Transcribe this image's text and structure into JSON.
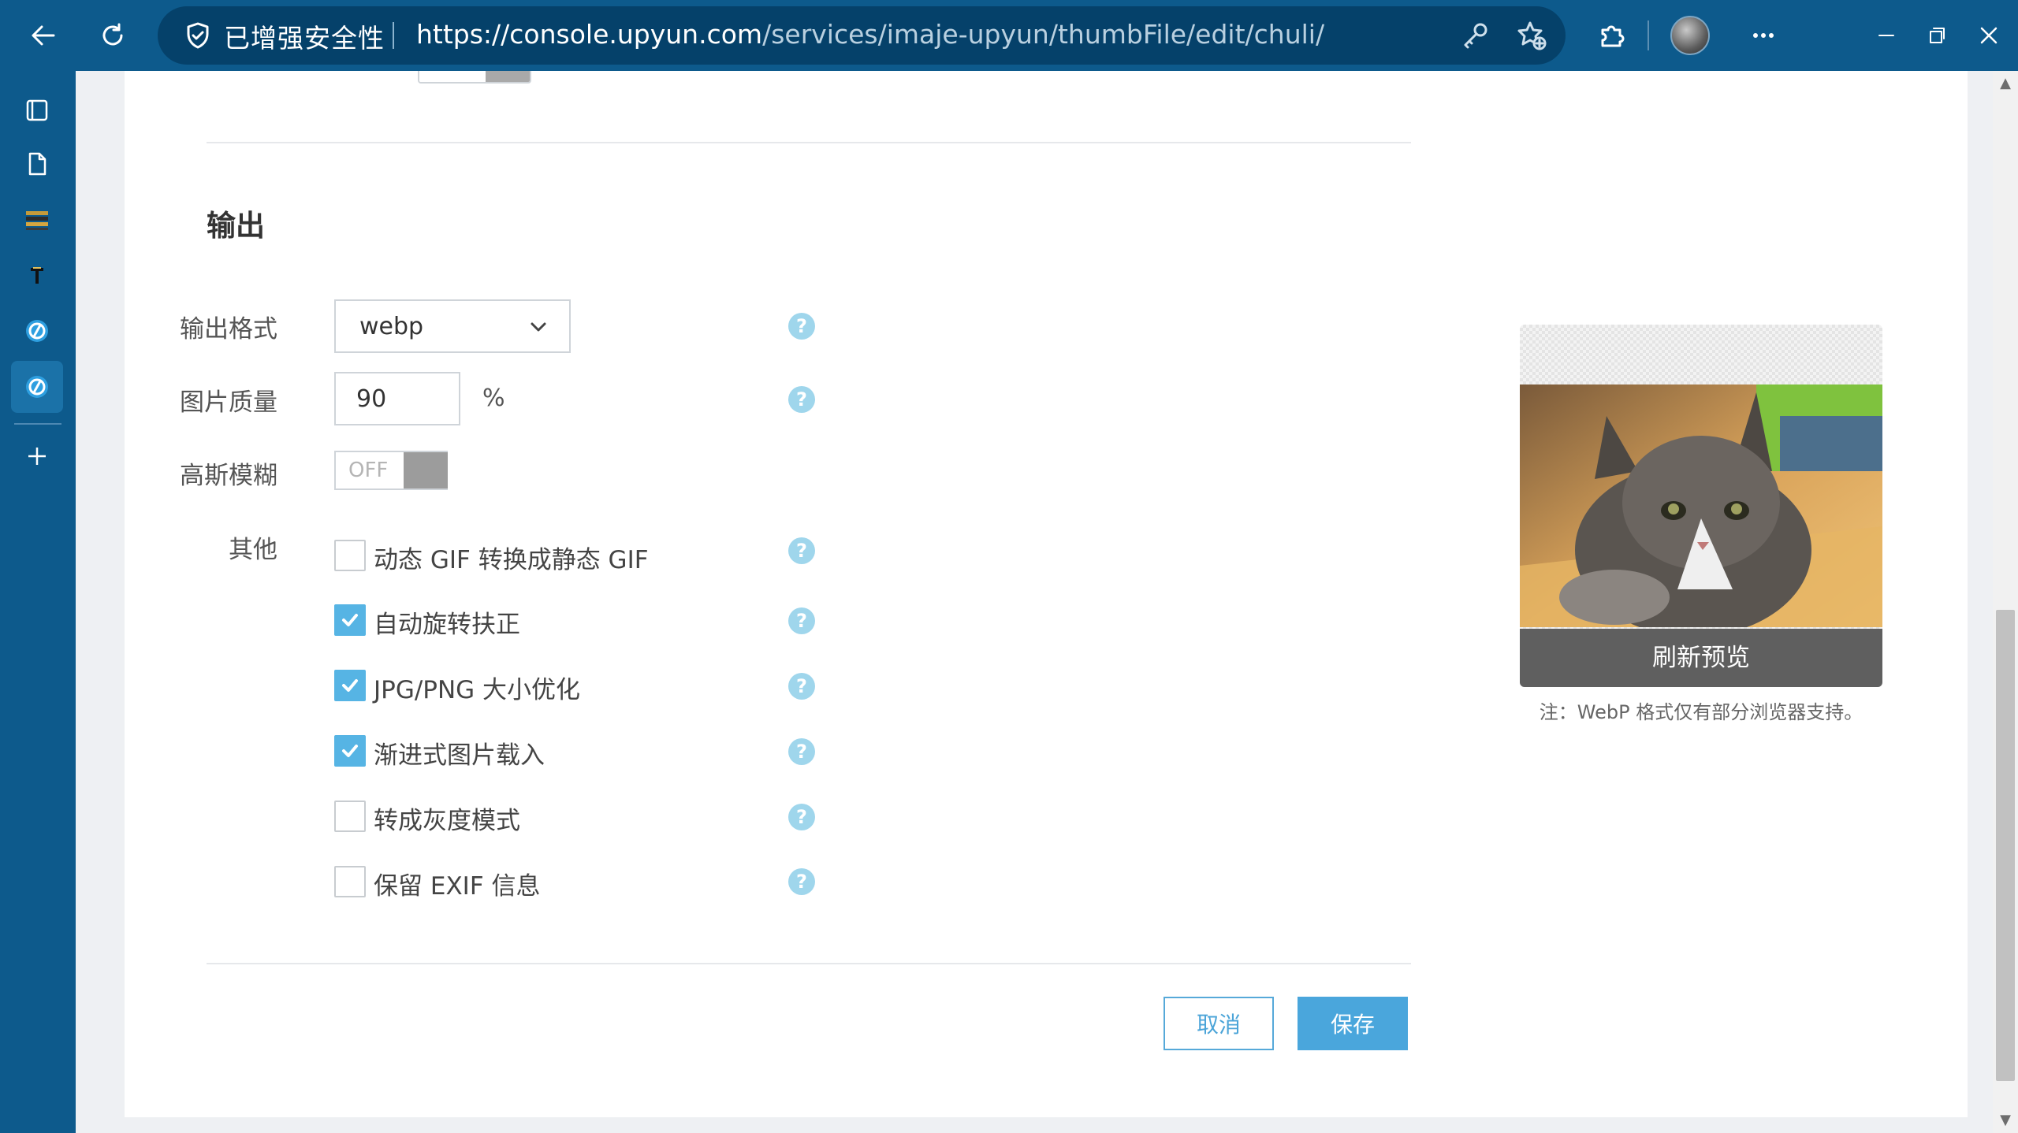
{
  "browser": {
    "security_label": "已增强安全性",
    "url_host": "https://console.upyun.com",
    "url_path": "/services/imaje-upyun/thumbFile/edit/chuli/"
  },
  "sidebar": {
    "items": [
      "tab-actions",
      "page",
      "app-strip",
      "text-tool",
      "upyun",
      "upyun-active",
      "add"
    ]
  },
  "form": {
    "section_title": "输出",
    "output_format": {
      "label": "输出格式",
      "value": "webp"
    },
    "quality": {
      "label": "图片质量",
      "value": "90",
      "unit": "%"
    },
    "blur": {
      "label": "高斯模糊",
      "state": "OFF"
    },
    "other": {
      "label": "其他",
      "options": [
        {
          "label": "动态 GIF 转换成静态 GIF",
          "checked": false
        },
        {
          "label": "自动旋转扶正",
          "checked": true
        },
        {
          "label": "JPG/PNG 大小优化",
          "checked": true
        },
        {
          "label": "渐进式图片载入",
          "checked": true
        },
        {
          "label": "转成灰度模式",
          "checked": false
        },
        {
          "label": "保留 EXIF 信息",
          "checked": false
        }
      ]
    },
    "help_glyph": "?",
    "cancel": "取消",
    "save": "保存"
  },
  "preview": {
    "refresh": "刷新预览",
    "note": "注：WebP 格式仅有部分浏览器支持。"
  },
  "colors": {
    "chrome": "#0d5a8c",
    "accent": "#4aa6dc",
    "help": "#9fd6ec"
  }
}
